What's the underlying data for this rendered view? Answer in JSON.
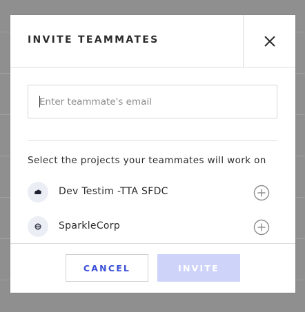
{
  "modal": {
    "title": "INVITE TEAMMATES"
  },
  "email": {
    "placeholder": "Enter teammate's email",
    "value": ""
  },
  "projects": {
    "label": "Select the projects your teammates will work on",
    "items": [
      {
        "name": "Dev Testim -TTA SFDC",
        "icon": "cloud-icon"
      },
      {
        "name": "SparkleCorp",
        "icon": "globe-icon"
      }
    ]
  },
  "footer": {
    "cancel_label": "CANCEL",
    "invite_label": "INVITE"
  },
  "colors": {
    "accent": "#3a4fd6",
    "invite_disabled": "#ced3fa",
    "backdrop": "#8f8f8f"
  }
}
